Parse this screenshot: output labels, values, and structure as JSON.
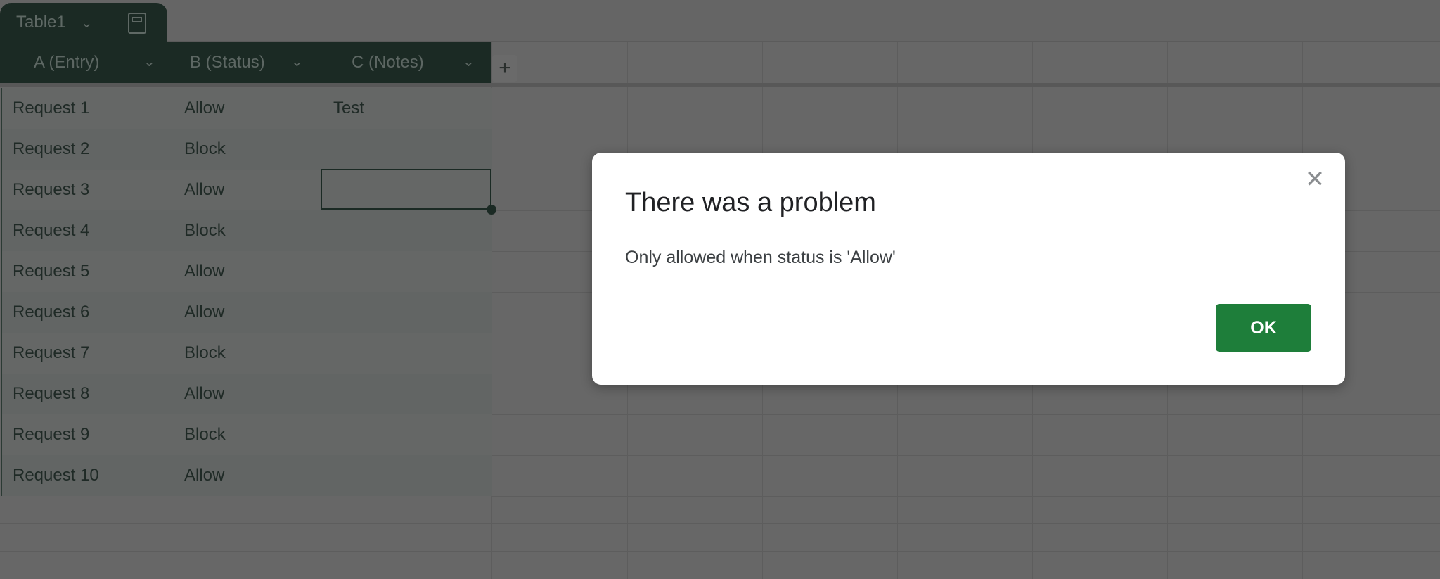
{
  "table": {
    "name": "Table1",
    "columns": [
      {
        "label": "A (Entry)"
      },
      {
        "label": "B (Status)"
      },
      {
        "label": "C (Notes)"
      }
    ],
    "add_column_label": "+",
    "rows": [
      [
        "Request 1",
        "Allow",
        "Test"
      ],
      [
        "Request 2",
        "Block",
        ""
      ],
      [
        "Request 3",
        "Allow",
        ""
      ],
      [
        "Request 4",
        "Block",
        ""
      ],
      [
        "Request 5",
        "Allow",
        ""
      ],
      [
        "Request 6",
        "Allow",
        ""
      ],
      [
        "Request 7",
        "Block",
        ""
      ],
      [
        "Request 8",
        "Allow",
        ""
      ],
      [
        "Request 9",
        "Block",
        ""
      ],
      [
        "Request 10",
        "Allow",
        ""
      ]
    ],
    "selected_cell": "C3"
  },
  "dialog": {
    "title": "There was a problem",
    "message": "Only allowed when status is 'Allow'",
    "ok_label": "OK",
    "close_glyph": "✕"
  },
  "colors": {
    "accent": "#1e7e3a",
    "table_header": "#1b2a24"
  }
}
